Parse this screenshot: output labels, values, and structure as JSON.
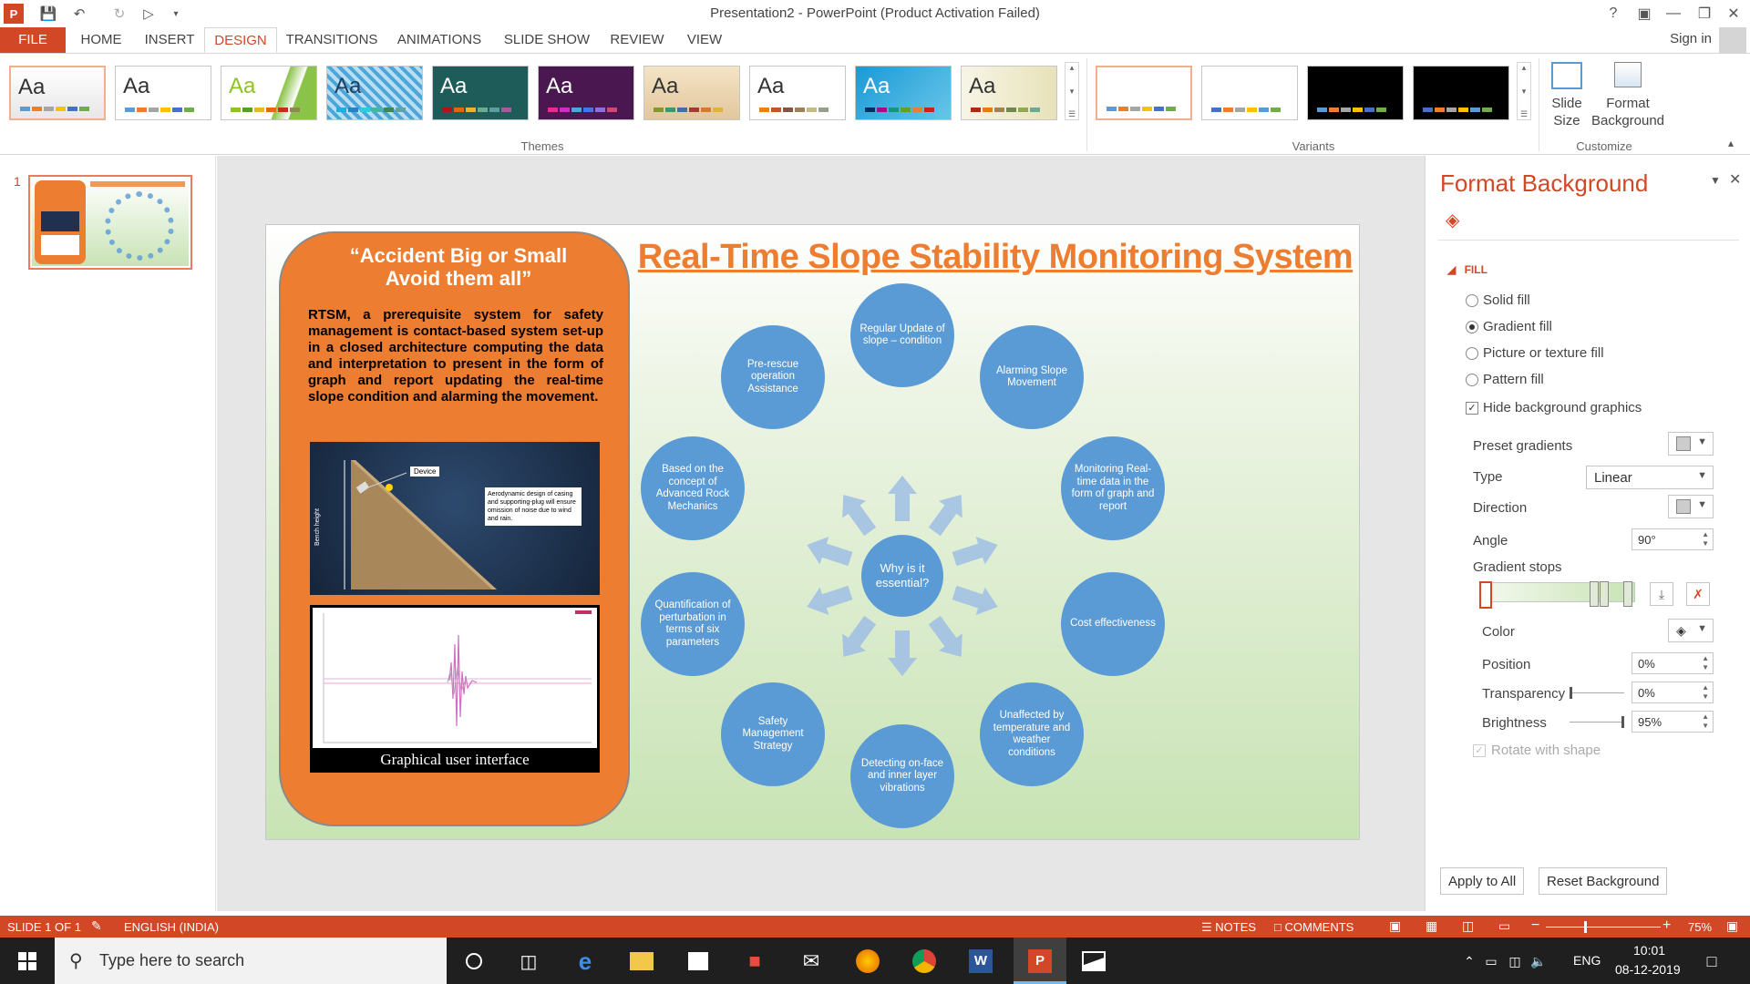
{
  "window": {
    "title": "Presentation2 - PowerPoint (Product Activation Failed)",
    "help": "?"
  },
  "ribbon": {
    "tabs": [
      "FILE",
      "HOME",
      "INSERT",
      "DESIGN",
      "TRANSITIONS",
      "ANIMATIONS",
      "SLIDE SHOW",
      "REVIEW",
      "VIEW"
    ],
    "active_tab": "DESIGN",
    "sign_in": "Sign in",
    "themes_label": "Themes",
    "variants_label": "Variants",
    "customize_label": "Customize",
    "theme_sample": "Aa",
    "slide_size_label": "Slide Size",
    "format_background_label": "Format Background"
  },
  "thumbnail": {
    "slide_number": "1"
  },
  "slide": {
    "quote": "“Accident Big or Small Avoid them all”",
    "title": "Real-Time Slope Stability Monitoring System",
    "description": "RTSM, a prerequisite system for safety management is contact-based system set-up in a closed architecture computing the data and interpretation to present in the form of graph and report updating the real-time slope condition and alarming the movement.",
    "device_label": "Device",
    "device_note": "Aerodynamic design of casing and supporting-plug will ensure omission of noise due to wind and rain.",
    "axis_label": "Bench height",
    "gui_caption": "Graphical user interface",
    "center_circle": "Why is it essential?",
    "circles": [
      "Regular Update of slope – condition",
      "Alarming Slope Movement",
      "Monitoring Real-time data in the form of graph and report",
      "Cost effectiveness",
      "Unaffected by temperature and weather conditions",
      "Detecting on-face and inner layer vibrations",
      "Safety Management Strategy",
      "Quantification of perturbation in terms of six parameters",
      "Based on the concept of Advanced Rock Mechanics",
      "Pre-rescue operation Assistance"
    ]
  },
  "format_pane": {
    "title": "Format Background",
    "section": "FILL",
    "options": {
      "solid": "Solid fill",
      "gradient": "Gradient fill",
      "picture": "Picture or texture fill",
      "pattern": "Pattern fill"
    },
    "selected_fill": "Gradient fill",
    "hide_graphics": "Hide background graphics",
    "hide_graphics_checked": true,
    "preset_gradients": "Preset gradients",
    "type_label": "Type",
    "type_value": "Linear",
    "direction_label": "Direction",
    "angle_label": "Angle",
    "angle_value": "90°",
    "gradient_stops_label": "Gradient stops",
    "color_label": "Color",
    "position_label": "Position",
    "position_value": "0%",
    "transparency_label": "Transparency",
    "transparency_value": "0%",
    "brightness_label": "Brightness",
    "brightness_value": "95%",
    "rotate_label": "Rotate with shape",
    "apply_all": "Apply to All",
    "reset": "Reset Background"
  },
  "status": {
    "slide": "SLIDE 1 OF 1",
    "language": "ENGLISH (INDIA)",
    "notes": "NOTES",
    "comments": "COMMENTS",
    "zoom": "75%"
  },
  "taskbar": {
    "search_placeholder": "Type here to search",
    "lang": "ENG",
    "time": "10:01",
    "date": "08-12-2019"
  },
  "colors": {
    "accent": "#d24726",
    "slide_orange": "#ed7d31",
    "circle_blue": "#5b9bd5"
  }
}
